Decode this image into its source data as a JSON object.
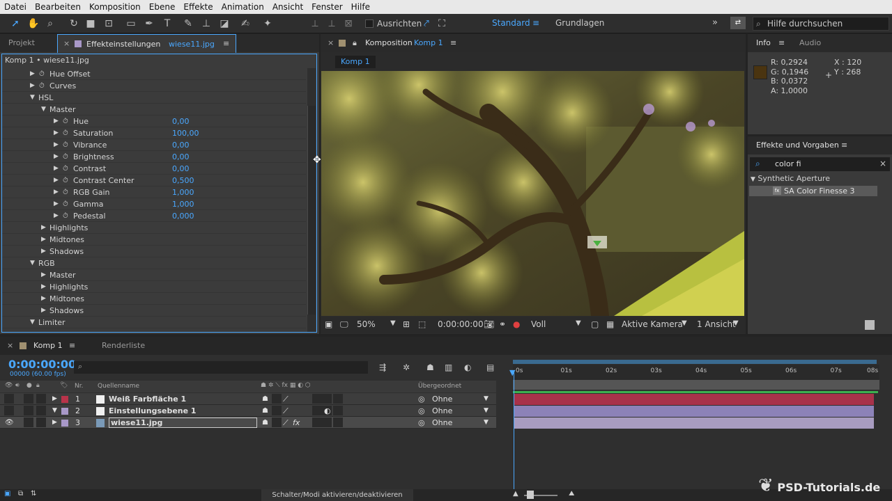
{
  "menu": [
    "Datei",
    "Bearbeiten",
    "Komposition",
    "Ebene",
    "Effekte",
    "Animation",
    "Ansicht",
    "Fenster",
    "Hilfe"
  ],
  "toolbar": {
    "align_label": "Ausrichten",
    "workspace_active": "Standard",
    "workspace_other": "Grundlagen",
    "help_placeholder": "Hilfe durchsuchen"
  },
  "project_tab": "Projekt",
  "effects_panel": {
    "tab_label": "Effekteinstellungen",
    "tab_file": "wiese11.jpg",
    "header": "Komp 1 • wiese11.jpg",
    "rows": [
      {
        "label": "Hue Offset",
        "indent": 1,
        "open": false,
        "stopwatch": true,
        "value": ""
      },
      {
        "label": "Curves",
        "indent": 1,
        "open": false,
        "stopwatch": true,
        "value": ""
      },
      {
        "label": "HSL",
        "indent": 0,
        "open": true,
        "stopwatch": false,
        "value": ""
      },
      {
        "label": "Master",
        "indent": 2,
        "open": true,
        "stopwatch": false,
        "value": ""
      },
      {
        "label": "Hue",
        "indent": 3,
        "open": false,
        "stopwatch": true,
        "value": "0,00"
      },
      {
        "label": "Saturation",
        "indent": 3,
        "open": false,
        "stopwatch": true,
        "value": "100,00"
      },
      {
        "label": "Vibrance",
        "indent": 3,
        "open": false,
        "stopwatch": true,
        "value": "0,00"
      },
      {
        "label": "Brightness",
        "indent": 3,
        "open": false,
        "stopwatch": true,
        "value": "0,00"
      },
      {
        "label": "Contrast",
        "indent": 3,
        "open": false,
        "stopwatch": true,
        "value": "0,00"
      },
      {
        "label": "Contrast Center",
        "indent": 3,
        "open": false,
        "stopwatch": true,
        "value": "0,500"
      },
      {
        "label": "RGB Gain",
        "indent": 3,
        "open": false,
        "stopwatch": true,
        "value": "1,000"
      },
      {
        "label": "Gamma",
        "indent": 3,
        "open": false,
        "stopwatch": true,
        "value": "1,000"
      },
      {
        "label": "Pedestal",
        "indent": 3,
        "open": false,
        "stopwatch": true,
        "value": "0,000"
      },
      {
        "label": "Highlights",
        "indent": 2,
        "open": false,
        "stopwatch": false,
        "value": ""
      },
      {
        "label": "Midtones",
        "indent": 2,
        "open": false,
        "stopwatch": false,
        "value": ""
      },
      {
        "label": "Shadows",
        "indent": 2,
        "open": false,
        "stopwatch": false,
        "value": ""
      },
      {
        "label": "RGB",
        "indent": 0,
        "open": true,
        "stopwatch": false,
        "value": ""
      },
      {
        "label": "Master",
        "indent": 2,
        "open": false,
        "stopwatch": false,
        "value": ""
      },
      {
        "label": "Highlights",
        "indent": 2,
        "open": false,
        "stopwatch": false,
        "value": ""
      },
      {
        "label": "Midtones",
        "indent": 2,
        "open": false,
        "stopwatch": false,
        "value": ""
      },
      {
        "label": "Shadows",
        "indent": 2,
        "open": false,
        "stopwatch": false,
        "value": ""
      },
      {
        "label": "Limiter",
        "indent": 0,
        "open": true,
        "stopwatch": false,
        "value": ""
      }
    ]
  },
  "composition": {
    "tab_prefix": "Komposition",
    "tab_name": "Komp 1",
    "sub_tab": "Komp 1",
    "zoom": "50%",
    "time": "0:00:00:00",
    "resolution": "Voll",
    "camera": "Aktive Kamera",
    "views": "1 Ansicht"
  },
  "info": {
    "tab": "Info",
    "tab2": "Audio",
    "r": "R: 0,2924",
    "g": "G: 0,1946",
    "b": "B: 0,0372",
    "a": "A: 1,0000",
    "x": "X : 120",
    "y": "Y : 268",
    "swatch_color": "#4a3410"
  },
  "presets": {
    "title": "Effekte und Vorgaben",
    "search": "color fi",
    "group": "Synthetic Aperture",
    "item": "SA Color Finesse 3"
  },
  "timeline": {
    "tab": "Komp 1",
    "tab2": "Renderliste",
    "timecode": "0:00:00:00",
    "fps": "00000 (60.00 fps)",
    "col_nr": "Nr.",
    "col_source": "Quellenname",
    "col_parent": "Übergeordnet",
    "ticks": [
      "0s",
      "01s",
      "02s",
      "03s",
      "04s",
      "05s",
      "06s",
      "07s",
      "08s"
    ],
    "layers": [
      {
        "nr": "1",
        "name": "Weiß Farbfläche 1",
        "color": "#b8334a",
        "parent": "Ohne",
        "track": "#a8324a"
      },
      {
        "nr": "2",
        "name": "Einstellungsebene 1",
        "color": "#a898c8",
        "parent": "Ohne",
        "track": "#8c82b8"
      },
      {
        "nr": "3",
        "name": "wiese11.jpg",
        "color": "#a898c8",
        "parent": "Ohne",
        "track": "#a89cc0"
      }
    ]
  },
  "status": {
    "toggle": "Schalter/Modi aktivieren/deaktivieren"
  },
  "watermark": "PSD-Tutorials.de"
}
